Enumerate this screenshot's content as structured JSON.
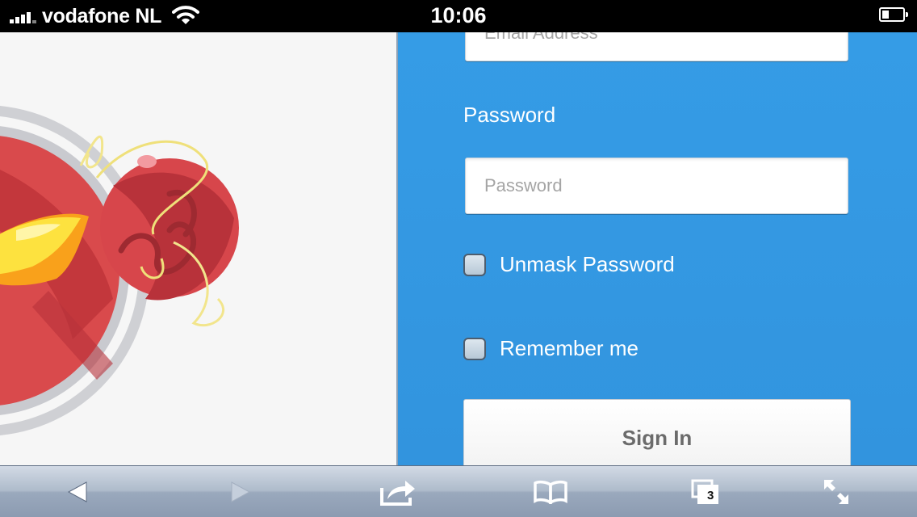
{
  "status_bar": {
    "carrier": "vodafone NL",
    "time": "10:06",
    "signal_bars": 5,
    "icons": [
      "signal-icon",
      "wifi-icon",
      "battery-icon"
    ]
  },
  "login_form": {
    "email_placeholder": "Email Address",
    "password_label": "Password",
    "password_placeholder": "Password",
    "unmask_label": "Unmask Password",
    "unmask_checked": false,
    "remember_label": "Remember me",
    "remember_checked": false,
    "sign_in_label": "Sign In",
    "accent_color": "#359ce6"
  },
  "toolbar": {
    "buttons": [
      "back-icon",
      "forward-icon",
      "share-icon",
      "bookmarks-icon",
      "tabs-icon",
      "fullscreen-icon"
    ],
    "tab_count": "3"
  }
}
